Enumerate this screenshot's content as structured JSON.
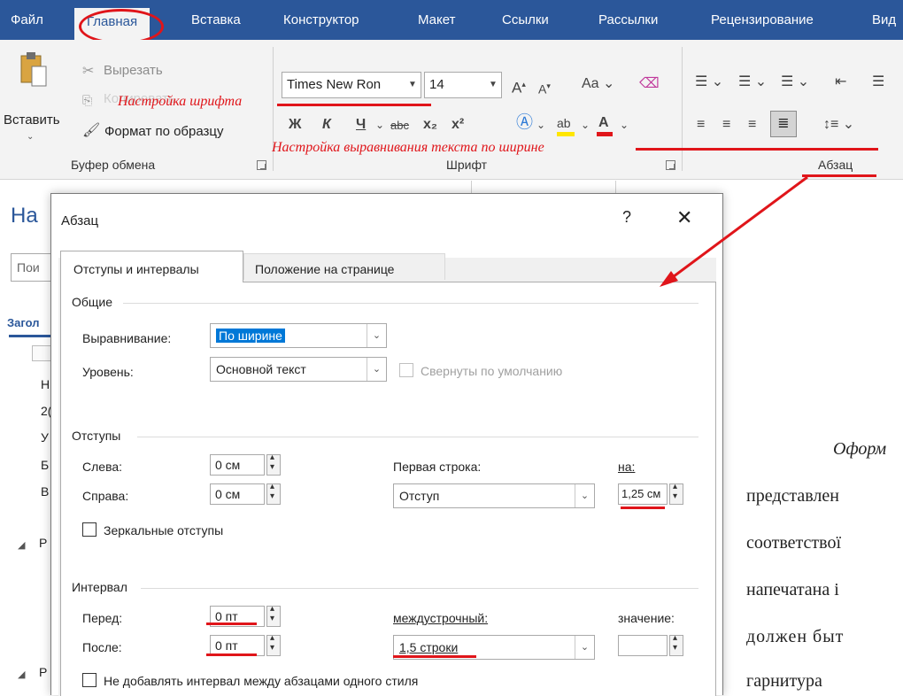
{
  "tabs": [
    "Файл",
    "Главная",
    "Вставка",
    "Конструктор",
    "Макет",
    "Ссылки",
    "Рассылки",
    "Рецензирование",
    "Вид"
  ],
  "ribbon": {
    "clipboard": {
      "paste_label": "Вставить",
      "cut_label": "Вырезать",
      "copy_label": "Копировать",
      "format_painter_label": "Формат по образцу",
      "group_label": "Буфер обмена"
    },
    "font": {
      "font_name": "Times New Ron",
      "font_size": "14",
      "case_label": "Aa",
      "bold": "Ж",
      "italic": "К",
      "underline": "Ч",
      "strikethrough": "abc",
      "subscript": "x₂",
      "superscript": "x²",
      "group_label": "Шрифт"
    },
    "paragraph": {
      "group_label": "Абзац"
    }
  },
  "annotations": {
    "font_note": "Настройка шрифта",
    "align_note": "Настройка выравнивания текста по ширине"
  },
  "nav_pane": {
    "title_partial": "На",
    "search_partial": "Пои",
    "headings_partial": "Загол",
    "items_partial": [
      "Н",
      "2(",
      "У",
      "Б",
      "В"
    ],
    "tree_items_partial": [
      "Р",
      "Р"
    ]
  },
  "document_lines": [
    "Оформ",
    "представлен",
    "соответствої",
    "напечатана і",
    "должен быт",
    "гарнитура"
  ],
  "dialog": {
    "title": "Абзац",
    "help": "?",
    "close": "✕",
    "tabs": [
      "Отступы и интервалы",
      "Положение на странице"
    ],
    "general": {
      "heading": "Общие",
      "alignment_label": "Выравнивание:",
      "alignment_value": "По ширине",
      "level_label": "Уровень:",
      "level_value": "Основной текст",
      "collapsed_label": "Свернуты по умолчанию"
    },
    "indents": {
      "heading": "Отступы",
      "left_label": "Слева:",
      "left_value": "0 см",
      "right_label": "Справа:",
      "right_value": "0 см",
      "first_line_label": "Первая строка:",
      "first_line_value": "Отступ",
      "by_label": "на:",
      "by_value": "1,25 см",
      "mirror_label": "Зеркальные отступы"
    },
    "spacing": {
      "heading": "Интервал",
      "before_label": "Перед:",
      "before_value": "0 пт",
      "after_label": "После:",
      "after_value": "0 пт",
      "line_spacing_label": "междустрочный:",
      "line_spacing_value": "1,5 строки",
      "at_label": "значение:",
      "at_value": "",
      "dont_add_label": "Не добавлять интервал между абзацами одного стиля"
    }
  },
  "colors": {
    "titlebar": "#2b579a",
    "ribbon": "#f3f3f3",
    "annotation_red": "#e0151a",
    "selection_blue": "#0078d7"
  }
}
